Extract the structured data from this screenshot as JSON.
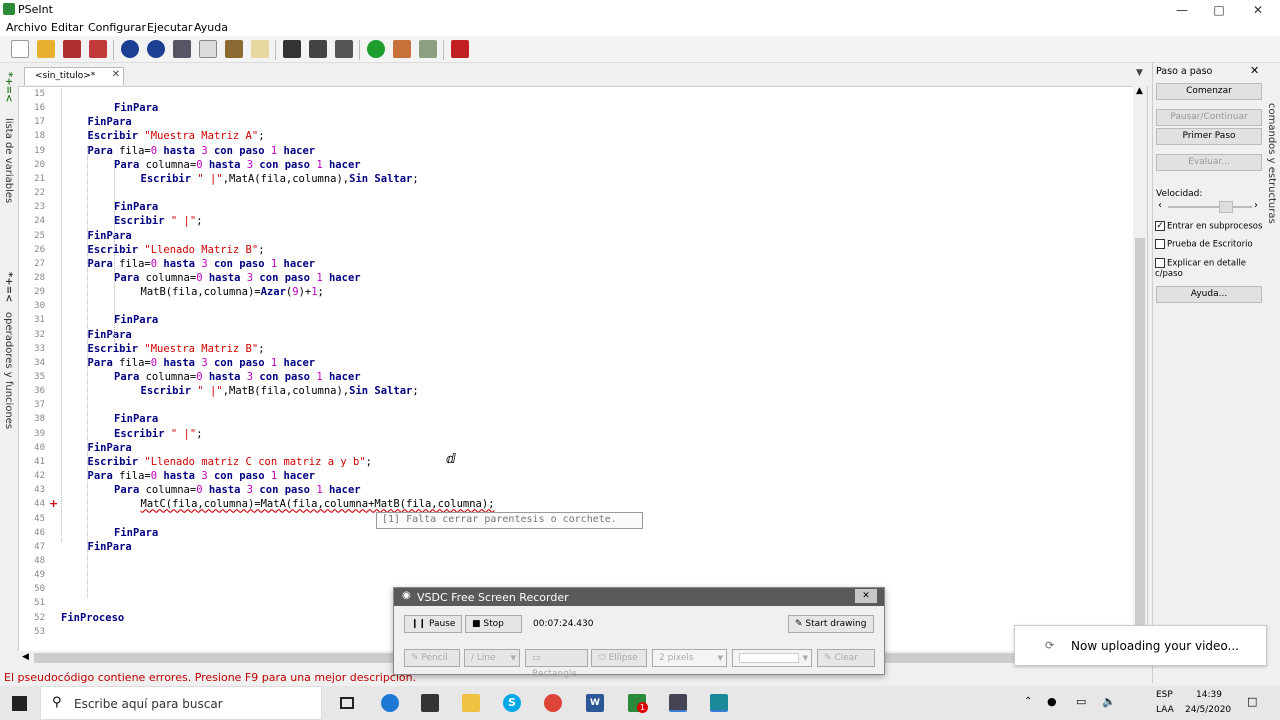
{
  "window": {
    "title": "PSeInt"
  },
  "menu": [
    "Archivo",
    "Editar",
    "Configurar",
    "Ejecutar",
    "Ayuda"
  ],
  "left_tabs": [
    "lista de variables",
    "operadores y funciones"
  ],
  "left_tab_icons": [
    "*+=<",
    "*+=<"
  ],
  "editor_tab": {
    "label": "<sin_titulo>*"
  },
  "code_lines": [
    {
      "n": "15",
      "indent": 0,
      "parts": []
    },
    {
      "n": "16",
      "indent": 2,
      "parts": [
        [
          "kw",
          "FinPara"
        ]
      ]
    },
    {
      "n": "17",
      "indent": 1,
      "parts": [
        [
          "kw",
          "FinPara"
        ]
      ]
    },
    {
      "n": "18",
      "indent": 1,
      "parts": [
        [
          "kw",
          "Escribir "
        ],
        [
          "str",
          "\"Muestra Matriz A\""
        ],
        [
          "",
          "; "
        ]
      ]
    },
    {
      "n": "19",
      "indent": 1,
      "parts": [
        [
          "kw",
          "Para "
        ],
        [
          "",
          "fila="
        ],
        [
          "num",
          "0"
        ],
        [
          "kw",
          " hasta "
        ],
        [
          "num",
          "3"
        ],
        [
          "kw",
          " con paso "
        ],
        [
          "num",
          "1"
        ],
        [
          "kw",
          " hacer"
        ]
      ]
    },
    {
      "n": "20",
      "indent": 2,
      "parts": [
        [
          "kw",
          "Para "
        ],
        [
          "",
          "columna="
        ],
        [
          "num",
          "0"
        ],
        [
          "kw",
          " hasta "
        ],
        [
          "num",
          "3"
        ],
        [
          "kw",
          " con paso "
        ],
        [
          "num",
          "1"
        ],
        [
          "kw",
          " hacer"
        ]
      ]
    },
    {
      "n": "21",
      "indent": 3,
      "parts": [
        [
          "kw",
          "Escribir "
        ],
        [
          "str",
          "\" |\""
        ],
        [
          "",
          ",MatA(fila,columna),"
        ],
        [
          "kw",
          "Sin Saltar"
        ],
        [
          "",
          ";"
        ]
      ]
    },
    {
      "n": "22",
      "indent": 0,
      "parts": []
    },
    {
      "n": "23",
      "indent": 2,
      "parts": [
        [
          "kw",
          "FinPara"
        ]
      ]
    },
    {
      "n": "24",
      "indent": 2,
      "parts": [
        [
          "kw",
          "Escribir "
        ],
        [
          "str",
          "\" |\""
        ],
        [
          "",
          ";"
        ]
      ]
    },
    {
      "n": "25",
      "indent": 1,
      "parts": [
        [
          "kw",
          "FinPara"
        ]
      ]
    },
    {
      "n": "26",
      "indent": 1,
      "parts": [
        [
          "kw",
          "Escribir "
        ],
        [
          "str",
          "\"Llenado Matriz B\""
        ],
        [
          "",
          ";"
        ]
      ]
    },
    {
      "n": "27",
      "indent": 1,
      "parts": [
        [
          "kw",
          "Para "
        ],
        [
          "",
          "fila="
        ],
        [
          "num",
          "0"
        ],
        [
          "kw",
          " hasta "
        ],
        [
          "num",
          "3"
        ],
        [
          "kw",
          " con paso "
        ],
        [
          "num",
          "1"
        ],
        [
          "kw",
          " hacer"
        ]
      ]
    },
    {
      "n": "28",
      "indent": 2,
      "parts": [
        [
          "kw",
          "Para "
        ],
        [
          "",
          "columna="
        ],
        [
          "num",
          "0"
        ],
        [
          "kw",
          " hasta "
        ],
        [
          "num",
          "3"
        ],
        [
          "kw",
          " con paso "
        ],
        [
          "num",
          "1"
        ],
        [
          "kw",
          " hacer"
        ]
      ]
    },
    {
      "n": "29",
      "indent": 3,
      "parts": [
        [
          "",
          "MatB(fila,columna)="
        ],
        [
          "kw",
          "Azar"
        ],
        [
          "",
          "("
        ],
        [
          "num",
          "9"
        ],
        [
          "",
          ")+"
        ],
        [
          "num",
          "1"
        ],
        [
          "",
          ";"
        ]
      ]
    },
    {
      "n": "30",
      "indent": 0,
      "parts": []
    },
    {
      "n": "31",
      "indent": 2,
      "parts": [
        [
          "kw",
          "FinPara"
        ]
      ]
    },
    {
      "n": "32",
      "indent": 1,
      "parts": [
        [
          "kw",
          "FinPara"
        ]
      ]
    },
    {
      "n": "33",
      "indent": 1,
      "parts": [
        [
          "kw",
          "Escribir "
        ],
        [
          "str",
          "\"Muestra Matriz B\""
        ],
        [
          "",
          ";"
        ]
      ]
    },
    {
      "n": "34",
      "indent": 1,
      "parts": [
        [
          "kw",
          "Para "
        ],
        [
          "",
          "fila="
        ],
        [
          "num",
          "0"
        ],
        [
          "kw",
          " hasta "
        ],
        [
          "num",
          "3"
        ],
        [
          "kw",
          " con paso "
        ],
        [
          "num",
          "1"
        ],
        [
          "kw",
          " hacer"
        ]
      ]
    },
    {
      "n": "35",
      "indent": 2,
      "parts": [
        [
          "kw",
          "Para "
        ],
        [
          "",
          "columna="
        ],
        [
          "num",
          "0"
        ],
        [
          "kw",
          " hasta "
        ],
        [
          "num",
          "3"
        ],
        [
          "kw",
          " con paso "
        ],
        [
          "num",
          "1"
        ],
        [
          "kw",
          " hacer"
        ]
      ]
    },
    {
      "n": "36",
      "indent": 3,
      "parts": [
        [
          "kw",
          "Escribir "
        ],
        [
          "str",
          "\" |\""
        ],
        [
          "",
          ",MatB(fila,columna),"
        ],
        [
          "kw",
          "Sin Saltar"
        ],
        [
          "",
          ";"
        ]
      ]
    },
    {
      "n": "37",
      "indent": 0,
      "parts": []
    },
    {
      "n": "38",
      "indent": 2,
      "parts": [
        [
          "kw",
          "FinPara"
        ]
      ]
    },
    {
      "n": "39",
      "indent": 2,
      "parts": [
        [
          "kw",
          "Escribir "
        ],
        [
          "str",
          "\" |\""
        ],
        [
          "",
          ";"
        ]
      ]
    },
    {
      "n": "40",
      "indent": 1,
      "parts": [
        [
          "kw",
          "FinPara"
        ]
      ]
    },
    {
      "n": "41",
      "indent": 1,
      "parts": [
        [
          "kw",
          "Escribir "
        ],
        [
          "str",
          "\"Llenado matriz C con matriz a y b\""
        ],
        [
          "",
          ";"
        ]
      ]
    },
    {
      "n": "42",
      "indent": 1,
      "parts": [
        [
          "kw",
          "Para "
        ],
        [
          "",
          "fila="
        ],
        [
          "num",
          "0"
        ],
        [
          "kw",
          " hasta "
        ],
        [
          "num",
          "3"
        ],
        [
          "kw",
          " con paso "
        ],
        [
          "num",
          "1"
        ],
        [
          "kw",
          " hacer"
        ]
      ]
    },
    {
      "n": "43",
      "indent": 2,
      "parts": [
        [
          "kw",
          "Para "
        ],
        [
          "",
          "columna="
        ],
        [
          "num",
          "0"
        ],
        [
          "kw",
          " hasta "
        ],
        [
          "num",
          "3"
        ],
        [
          "kw",
          " con paso "
        ],
        [
          "num",
          "1"
        ],
        [
          "kw",
          " hacer"
        ]
      ]
    },
    {
      "n": "44",
      "indent": 3,
      "parts": [
        [
          "",
          "MatC(fila,columna)=MatA(fila,columna+MatB(fila,columna);"
        ]
      ]
    },
    {
      "n": "45",
      "indent": 0,
      "parts": []
    },
    {
      "n": "46",
      "indent": 2,
      "parts": [
        [
          "kw",
          "FinPara"
        ]
      ]
    },
    {
      "n": "47",
      "indent": 1,
      "parts": [
        [
          "kw",
          "FinPara"
        ]
      ]
    },
    {
      "n": "48",
      "indent": 0,
      "parts": []
    },
    {
      "n": "49",
      "indent": 0,
      "parts": []
    },
    {
      "n": "50",
      "indent": 0,
      "parts": []
    },
    {
      "n": "51",
      "indent": 0,
      "parts": []
    },
    {
      "n": "52",
      "indent": 0,
      "parts": [
        [
          "kw",
          "FinProceso"
        ]
      ]
    },
    {
      "n": "53",
      "indent": 0,
      "parts": []
    }
  ],
  "error_marker": "+",
  "tooltip": "[1] Falta cerrar parentesis o corchete.",
  "status_message": "El pseudocódigo contiene errores. Presione F9 para una mejor descripción.",
  "step_panel": {
    "title": "Paso a paso",
    "start": "Comenzar",
    "pause": "Pausar/Continuar",
    "first_step": "Primer Paso",
    "evaluate": "Evaluar...",
    "speed_label": "Velocidad:",
    "speed_level": 0.5,
    "options": [
      {
        "label": "Entrar en subprocesos",
        "checked": true
      },
      {
        "label": "Prueba de Escritorio",
        "checked": false
      },
      {
        "label": "Explicar en detalle c/paso",
        "checked": false
      }
    ],
    "help": "Ayuda..."
  },
  "right_tab": "comandos y estructuras",
  "recorder": {
    "title": "VSDC Free Screen Recorder",
    "pause": "Pause",
    "stop": "Stop",
    "time": "00:07:24.430",
    "start_drawing": "Start drawing",
    "pencil": "Pencil",
    "line": "Line",
    "rectangle": "Rectangle",
    "ellipse": "Ellipse",
    "size": "2 pixels",
    "clear": "Clear"
  },
  "upload_toast": "Now uploading your video...",
  "taskbar": {
    "search_placeholder": "Escribe aquí para buscar",
    "lang1": "ESP",
    "lang2": "LAA",
    "time": "14:39",
    "date": "24/5/2020",
    "badge": "1"
  },
  "colors": {
    "keyword": "#000080",
    "string": "#d00000",
    "number": "#c000c0",
    "error": "#c00000"
  }
}
